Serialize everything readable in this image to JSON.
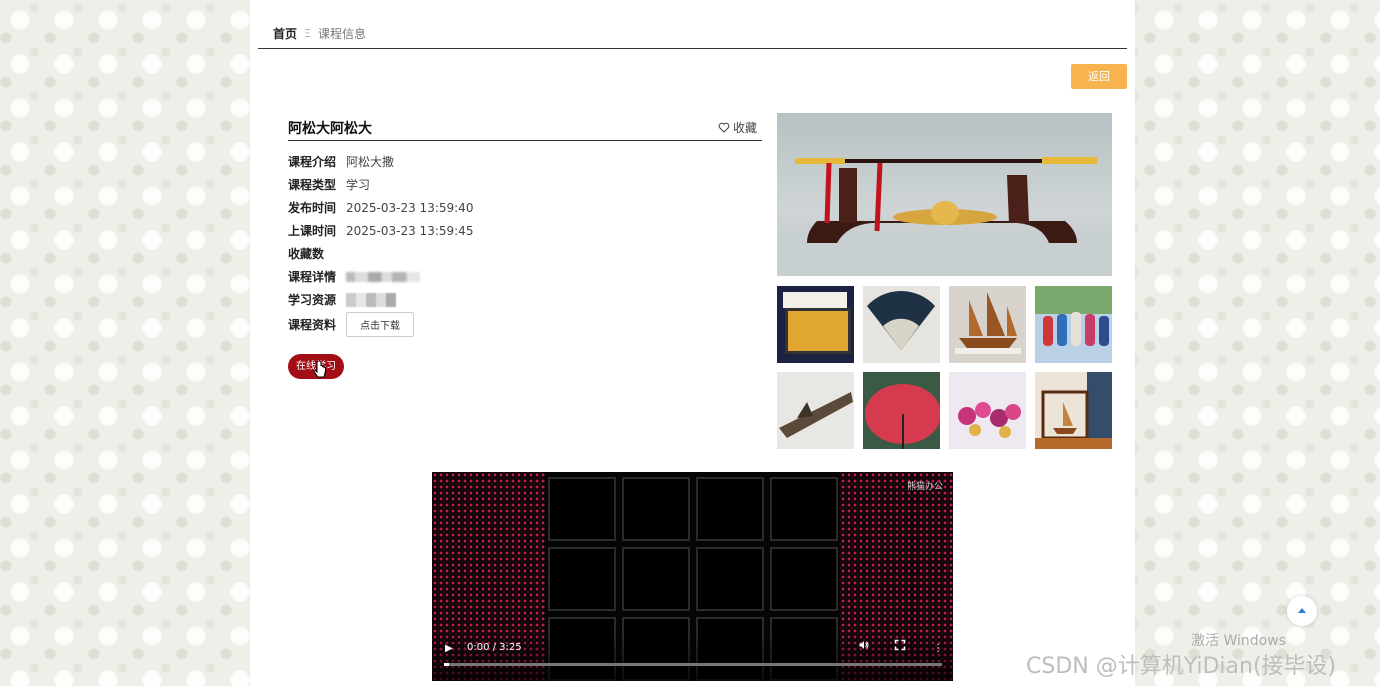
{
  "breadcrumb": {
    "home": "首页",
    "separator": "Ξ",
    "current": "课程信息"
  },
  "back_button": "返回",
  "course": {
    "title": "阿松大阿松大",
    "favorite_label": "收藏",
    "fields": [
      {
        "label": "课程介绍",
        "value": "阿松大撒"
      },
      {
        "label": "课程类型",
        "value": "学习"
      },
      {
        "label": "发布时间",
        "value": "2025-03-23 13:59:40"
      },
      {
        "label": "上课时间",
        "value": "2025-03-23 13:59:45"
      },
      {
        "label": "收藏数",
        "value": ""
      },
      {
        "label": "课程详情",
        "value": ""
      },
      {
        "label": "学习资源",
        "value": ""
      },
      {
        "label": "课程资料",
        "value": ""
      }
    ],
    "download_button": "点击下载",
    "online_button": "在线学习"
  },
  "video": {
    "watermark": "熊猫办公",
    "time": "0:00 / 3:25",
    "progress": 0.01
  },
  "watermarks": {
    "windows": "激活 Windows",
    "csdn": "CSDN @计算机YiDian(接毕设)"
  },
  "colors": {
    "back_button": "#f7b34e",
    "online_button": "#a30d16"
  }
}
